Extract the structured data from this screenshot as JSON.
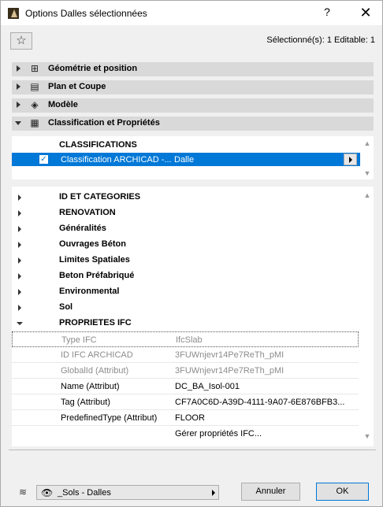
{
  "window": {
    "title": "Options Dalles sélectionnées",
    "help_label": "?",
    "close_label": "✕"
  },
  "toolbar": {
    "favorite_icon": "star-icon",
    "favorite_glyph": "☆",
    "selection_info": "Sélectionné(s): 1 Editable: 1"
  },
  "sections": [
    {
      "label": "Géométrie et position",
      "icon": "geometry-icon",
      "glyph": "⊞",
      "expanded": false
    },
    {
      "label": "Plan et Coupe",
      "icon": "floorplan-icon",
      "glyph": "▤",
      "expanded": false
    },
    {
      "label": "Modèle",
      "icon": "model-icon",
      "glyph": "◈",
      "expanded": false
    },
    {
      "label": "Classification et Propriétés",
      "icon": "document-icon",
      "glyph": "▦",
      "expanded": true
    }
  ],
  "classifications": {
    "header": "CLASSIFICATIONS",
    "row": {
      "name": "Classification ARCHICAD -...",
      "value": "Dalle",
      "checked": true
    }
  },
  "groups": [
    {
      "label": "ID ET CATEGORIES",
      "expanded": false
    },
    {
      "label": "RENOVATION",
      "expanded": false
    },
    {
      "label": "Généralités",
      "expanded": false
    },
    {
      "label": "Ouvrages Béton",
      "expanded": false
    },
    {
      "label": "Limites Spatiales",
      "expanded": false
    },
    {
      "label": "Beton Préfabriqué",
      "expanded": false
    },
    {
      "label": "Environmental",
      "expanded": false
    },
    {
      "label": "Sol",
      "expanded": false
    },
    {
      "label": "PROPRIETES IFC",
      "expanded": true
    }
  ],
  "ifc_props": [
    {
      "name": "Type IFC",
      "value": "IfcSlab",
      "editable": false
    },
    {
      "name": "ID IFC ARCHICAD",
      "value": "3FUWnjevr14Pe7ReTh_pMI",
      "editable": false
    },
    {
      "name": "GlobalId (Attribut)",
      "value": "3FUWnjevr14Pe7ReTh_pMI",
      "editable": false
    },
    {
      "name": "Name (Attribut)",
      "value": "DC_BA_Isol-001",
      "editable": true
    },
    {
      "name": "Tag (Attribut)",
      "value": "CF7A0C6D-A39D-4111-9A07-6E876BFB3...",
      "editable": true
    },
    {
      "name": "PredefinedType (Attribut)",
      "value": "FLOOR",
      "editable": true
    },
    {
      "name": "",
      "value": "Gérer propriétés IFC...",
      "editable": true
    }
  ],
  "footer": {
    "layer_icon": "layer-icon",
    "layer_glyph": "≋",
    "eye_icon": "eye-icon",
    "eye_glyph": "👁",
    "layer_value": "_Sols - Dalles",
    "cancel_label": "Annuler",
    "ok_label": "OK"
  }
}
